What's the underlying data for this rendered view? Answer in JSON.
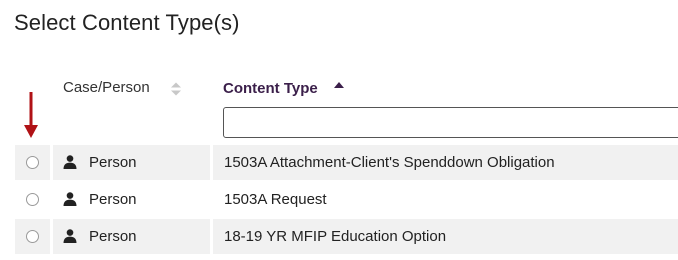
{
  "page": {
    "title": "Select Content Type(s)"
  },
  "colors": {
    "arrow": "#b01216",
    "header_accent": "#3b1f4a",
    "row_bg": "#f1f1f1"
  },
  "table": {
    "columns": {
      "case_person": "Case/Person",
      "content_type": "Content Type"
    },
    "sort": {
      "column": "content_type",
      "direction": "ascending"
    },
    "filter": {
      "value": "",
      "placeholder": ""
    },
    "rows": [
      {
        "case_person": "Person",
        "icon": "person-icon",
        "content_type": "1503A Attachment-Client's Spenddown Obligation",
        "selected": false
      },
      {
        "case_person": "Person",
        "icon": "person-icon",
        "content_type": "1503A Request",
        "selected": false
      },
      {
        "case_person": "Person",
        "icon": "person-icon",
        "content_type": "18-19 YR MFIP Education Option",
        "selected": false
      }
    ]
  }
}
